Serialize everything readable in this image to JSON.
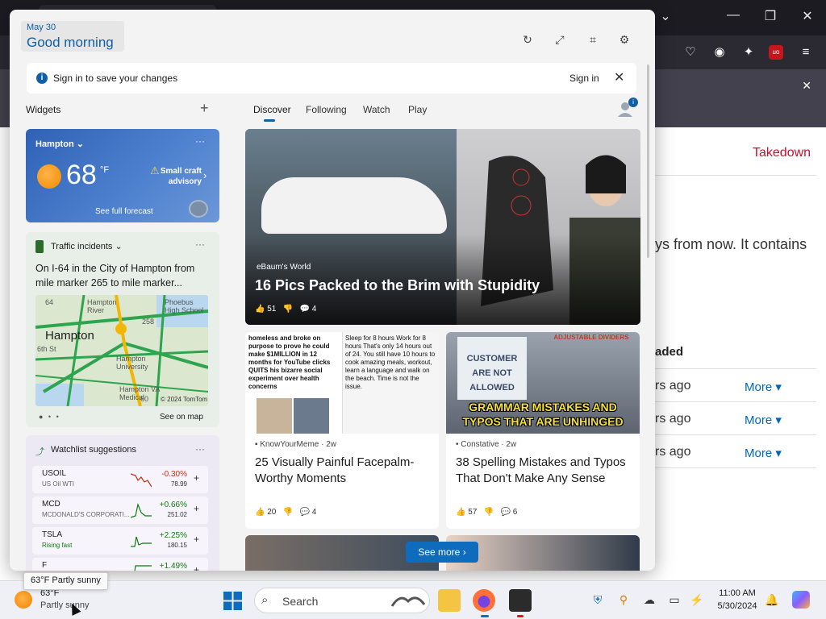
{
  "background_page": {
    "takedown": "Takedown",
    "fragment_text": "ys from now. It contains",
    "loaded_header": "aded",
    "rows": [
      {
        "time": "rs ago",
        "more": "More"
      },
      {
        "time": "rs ago",
        "more": "More"
      },
      {
        "time": "rs ago",
        "more": "More"
      }
    ]
  },
  "header": {
    "date": "May 30",
    "greeting": "Good morning"
  },
  "signin_bar": {
    "message": "Sign in to save your changes",
    "link": "Sign in"
  },
  "widgets": {
    "label": "Widgets",
    "add": "+"
  },
  "tabs": [
    {
      "label": "Discover",
      "active": true
    },
    {
      "label": "Following",
      "active": false
    },
    {
      "label": "Watch",
      "active": false
    },
    {
      "label": "Play",
      "active": false
    }
  ],
  "profile": {
    "badge": "i"
  },
  "weather": {
    "location": "Hampton",
    "temp": "68",
    "unit": "°F",
    "advisory": "Small craft advisory",
    "forecast_link": "See full forecast",
    "more": "···"
  },
  "traffic": {
    "title": "Traffic incidents",
    "description": "On I-64 in the City of Hampton from mile marker 265 to mile marker...",
    "map": {
      "city": "Hampton",
      "labels": [
        "Hampton River",
        "Phoebus High School",
        "Hampton University",
        "Hampton VA Medical",
        "6th St",
        "258",
        "64",
        "60"
      ],
      "copyright": "© 2024 TomTom"
    },
    "see_on_map": "See on map",
    "more": "···"
  },
  "watchlist": {
    "title": "Watchlist suggestions",
    "more": "···",
    "stocks": [
      {
        "symbol": "USOIL",
        "name": "US Oil WTI",
        "change": "-0.30%",
        "price": "78.99",
        "color": "#c42b1c"
      },
      {
        "symbol": "MCD",
        "name": "MCDONALD'S CORPORATI...",
        "change": "+0.66%",
        "price": "251.02",
        "color": "#0f7b0f"
      },
      {
        "symbol": "TSLA",
        "name": "Rising fast",
        "change": "+2.25%",
        "price": "180.15",
        "color": "#0f7b0f"
      },
      {
        "symbol": "F",
        "name": "",
        "change": "+1.49%",
        "price": "",
        "color": "#0f7b0f"
      }
    ]
  },
  "hero": {
    "source": "eBaum's World",
    "title": "16 Pics Packed to the Brim with Stupidity",
    "likes": "51",
    "comments": "4"
  },
  "cards": [
    {
      "source": "KnowYourMeme · 2w",
      "title": "25 Visually Painful Facepalm-Worthy Moments",
      "likes": "20",
      "comments": "4",
      "image_text_left": "homeless and broke on purpose to prove he could make $1MILLION in 12 months for YouTube clicks QUITS his bizarre social experiment over health concerns",
      "image_text_right": "Sleep for 8 hours Work for 8 hours That's only 14 hours out of 24. You still have 10 hours to cook amazing meals, workout, learn a language and walk on the beach. Time is not the issue."
    },
    {
      "source": "Constative · 2w",
      "title": "38 Spelling Mistakes and Typos That Don't Make Any Sense",
      "likes": "57",
      "comments": "6",
      "image_sign": "CUSTOMER ARE NOT ALLOWED",
      "image_banner": "ADJUSTABLE DIVIDERS",
      "image_caption": "GRAMMAR MISTAKES AND TYPOS THAT ARE UNHINGED"
    }
  ],
  "see_more": "See more",
  "taskbar": {
    "weather_temp": "63°F",
    "weather_cond": "Partly sunny",
    "tooltip": "63°F Partly sunny",
    "search": "Search",
    "time": "11:00 AM",
    "date": "5/30/2024"
  },
  "colors": {
    "accent": "#0f6cbd",
    "panel_bg": "#f3f3f3",
    "takedown": "#c8102e"
  }
}
